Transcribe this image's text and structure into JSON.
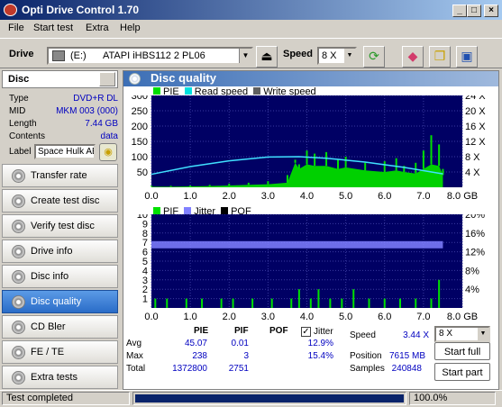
{
  "window": {
    "title": "Opti Drive Control 1.70"
  },
  "menu": [
    "File",
    "Start test",
    "Extra",
    "Help"
  ],
  "toolbar": {
    "drive_label": "Drive",
    "drive_letter": "(E:)",
    "drive_name": "ATAPI  iHBS112   2 PL06",
    "speed_label": "Speed",
    "speed_value": "8 X"
  },
  "disc": {
    "header": "Disc",
    "type_label": "Type",
    "type": "DVD+R DL",
    "mid_label": "MID",
    "mid": "MKM 003 (000)",
    "length_label": "Length",
    "length": "7.44 GB",
    "contents_label": "Contents",
    "contents": "data",
    "label_label": "Label",
    "label": "Space Hulk AE"
  },
  "nav": [
    "Transfer rate",
    "Create test disc",
    "Verify test disc",
    "Drive info",
    "Disc info",
    "Disc quality",
    "CD Bler",
    "FE / TE",
    "Extra tests"
  ],
  "nav_active": 5,
  "panel": {
    "title": "Disc quality"
  },
  "chart_data": [
    {
      "type": "bar",
      "legend": [
        "PIE",
        "Read speed",
        "Write speed"
      ],
      "y_left_ticks": [
        "300",
        "250",
        "200",
        "150",
        "100",
        "50"
      ],
      "y_right_ticks": [
        "24 X",
        "20 X",
        "16 X",
        "12 X",
        "8 X",
        "4 X"
      ],
      "x_ticks": [
        "0.0",
        "1.0",
        "2.0",
        "3.0",
        "4.0",
        "5.0",
        "6.0",
        "7.0",
        "8.0 GB"
      ],
      "xlim": [
        0,
        8
      ],
      "ylim": [
        0,
        300
      ],
      "pie_x": [
        0,
        0.5,
        1,
        1.5,
        2,
        2.5,
        3,
        3.5,
        3.7,
        3.8,
        4,
        4.2,
        4.5,
        4.8,
        5,
        5.5,
        6,
        6.3,
        6.5,
        6.8,
        7,
        7.2,
        7.4,
        7.5
      ],
      "pie_max": [
        5,
        5,
        6,
        8,
        12,
        15,
        20,
        40,
        90,
        75,
        120,
        110,
        115,
        90,
        100,
        80,
        85,
        95,
        70,
        80,
        120,
        170,
        140,
        60
      ],
      "pie_fill": [
        2,
        2,
        3,
        4,
        6,
        8,
        10,
        15,
        80,
        60,
        75,
        70,
        70,
        60,
        65,
        55,
        50,
        55,
        50,
        45,
        60,
        75,
        70,
        40
      ],
      "read_speed_x": [
        0,
        1,
        2,
        3,
        3.8,
        4.5,
        5.5,
        6.5,
        7.5
      ],
      "read_speed_x_speed": [
        3.4,
        5.4,
        6.9,
        7.9,
        8.0,
        7.6,
        6.6,
        5.2,
        3.5
      ]
    },
    {
      "type": "bar",
      "legend": [
        "PIF",
        "Jitter",
        "POF"
      ],
      "y_left_ticks": [
        "10",
        "9",
        "8",
        "7",
        "6",
        "5",
        "4",
        "3",
        "2",
        "1"
      ],
      "y_right_ticks": [
        "20%",
        "16%",
        "12%",
        "8%",
        "4%"
      ],
      "x_ticks": [
        "0.0",
        "1.0",
        "2.0",
        "3.0",
        "4.0",
        "5.0",
        "6.0",
        "7.0",
        "8.0 GB"
      ],
      "xlim": [
        0,
        8
      ],
      "ylim": [
        0,
        10
      ],
      "pif_x": [
        0.1,
        0.4,
        0.9,
        1.3,
        1.8,
        2.1,
        2.6,
        3.1,
        3.6,
        3.8,
        4.1,
        4.3,
        4.6,
        4.9,
        5.2,
        5.6,
        6.0,
        6.4,
        6.8,
        7.2,
        7.4
      ],
      "pif_v": [
        1,
        1,
        1,
        1,
        1,
        1,
        1,
        1,
        1,
        2,
        1,
        2,
        1,
        1,
        2,
        1,
        1,
        1,
        1,
        1,
        3
      ],
      "jitter_pct": 13.5
    }
  ],
  "stats": {
    "col_pie": "PIE",
    "col_pif": "PIF",
    "col_pof": "POF",
    "jitter_label": "Jitter",
    "avg_label": "Avg",
    "avg_pie": "45.07",
    "avg_pif": "0.01",
    "avg_jitter": "12.9%",
    "max_label": "Max",
    "max_pie": "238",
    "max_pif": "3",
    "max_jitter": "15.4%",
    "total_label": "Total",
    "total_pie": "1372800",
    "total_pif": "2751"
  },
  "right": {
    "speed_label": "Speed",
    "speed": "3.44 X",
    "speed_select": "8 X",
    "position_label": "Position",
    "position": "7615 MB",
    "samples_label": "Samples",
    "samples": "240848",
    "start_full": "Start full",
    "start_part": "Start part"
  },
  "status": {
    "text": "Test completed",
    "progress": "100.0%",
    "progress_value": 1.0
  }
}
